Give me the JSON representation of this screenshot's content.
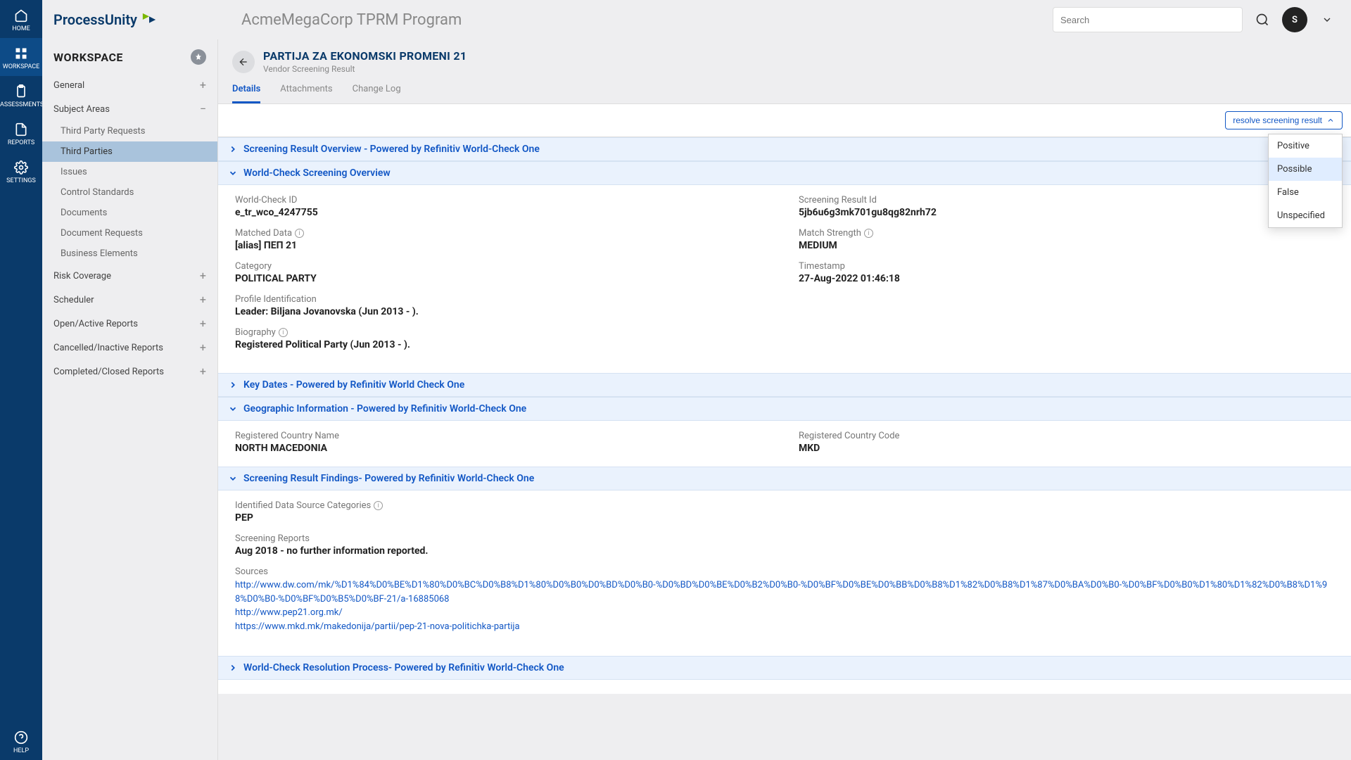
{
  "rail": {
    "home": "HOME",
    "workspace": "WORKSPACE",
    "assessments": "ASSESSMENTS",
    "reports": "REPORTS",
    "settings": "SETTINGS",
    "help": "HELP"
  },
  "header": {
    "logo_text": "ProcessUnity",
    "program": "AcmeMegaCorp TPRM Program",
    "search_placeholder": "Search",
    "avatar_initial": "S"
  },
  "sidebar": {
    "title": "WORKSPACE",
    "items": {
      "general": "General",
      "subject_areas": "Subject Areas",
      "risk_coverage": "Risk Coverage",
      "scheduler": "Scheduler",
      "open_reports": "Open/Active Reports",
      "cancelled_reports": "Cancelled/Inactive Reports",
      "completed_reports": "Completed/Closed Reports"
    },
    "subs": {
      "tpr": "Third Party Requests",
      "tp": "Third Parties",
      "issues": "Issues",
      "controls": "Control Standards",
      "docs": "Documents",
      "doc_req": "Document Requests",
      "biz_el": "Business Elements"
    }
  },
  "page": {
    "title": "PARTIJA ZA EKONOMSKI PROMENI 21",
    "subtitle": "Vendor Screening Result",
    "tabs": {
      "details": "Details",
      "attachments": "Attachments",
      "changelog": "Change Log"
    },
    "resolve_label": "resolve screening result",
    "dropdown": {
      "positive": "Positive",
      "possible": "Possible",
      "false": "False",
      "unspecified": "Unspecified"
    }
  },
  "sections": {
    "overview": "Screening Result Overview - Powered by Refinitiv World-Check One",
    "wc_overview": "World-Check Screening Overview",
    "key_dates": "Key Dates - Powered by Refinitiv World Check One",
    "geo": "Geographic Information - Powered by Refinitiv World-Check One",
    "findings": "Screening Result Findings- Powered by Refinitiv World-Check One",
    "resolution": "World-Check Resolution Process- Powered by Refinitiv World-Check One"
  },
  "fields": {
    "wc_id": {
      "label": "World-Check ID",
      "value": "e_tr_wco_4247755"
    },
    "sr_id": {
      "label": "Screening Result Id",
      "value": "5jb6u6g3mk701gu8qg82nrh72"
    },
    "matched": {
      "label": "Matched Data",
      "value": "[alias] ПЕП 21"
    },
    "strength": {
      "label": "Match Strength",
      "value": "MEDIUM"
    },
    "category": {
      "label": "Category",
      "value": "POLITICAL PARTY"
    },
    "timestamp": {
      "label": "Timestamp",
      "value": "27-Aug-2022 01:46:18"
    },
    "profile": {
      "label": "Profile Identification",
      "value": "Leader: Biljana Jovanovska (Jun 2013 - )."
    },
    "bio": {
      "label": "Biography",
      "value": "Registered Political Party (Jun 2013 - )."
    },
    "country": {
      "label": "Registered Country Name",
      "value": "NORTH MACEDONIA"
    },
    "code": {
      "label": "Registered Country Code",
      "value": "MKD"
    },
    "categories": {
      "label": "Identified Data Source Categories",
      "value": "PEP"
    },
    "reports": {
      "label": "Screening Reports",
      "value": "Aug 2018 - no further information reported."
    },
    "sources": {
      "label": "Sources",
      "l1": "http://www.dw.com/mk/%D1%84%D0%BE%D1%80%D0%BC%D0%B8%D1%80%D0%B0%D0%BD%D0%B0-%D0%BD%D0%BE%D0%B2%D0%B0-%D0%BF%D0%BE%D0%BB%D0%B8%D1%82%D0%B8%D1%87%D0%BA%D0%B0-%D0%BF%D0%B0%D1%80%D1%82%D0%B8%D1%98%D0%B0-%D0%BF%D0%B5%D0%BF-21/a-16885068",
      "l2": "http://www.pep21.org.mk/",
      "l3": "https://www.mkd.mk/makedonija/partii/pep-21-nova-politichka-partija"
    }
  }
}
